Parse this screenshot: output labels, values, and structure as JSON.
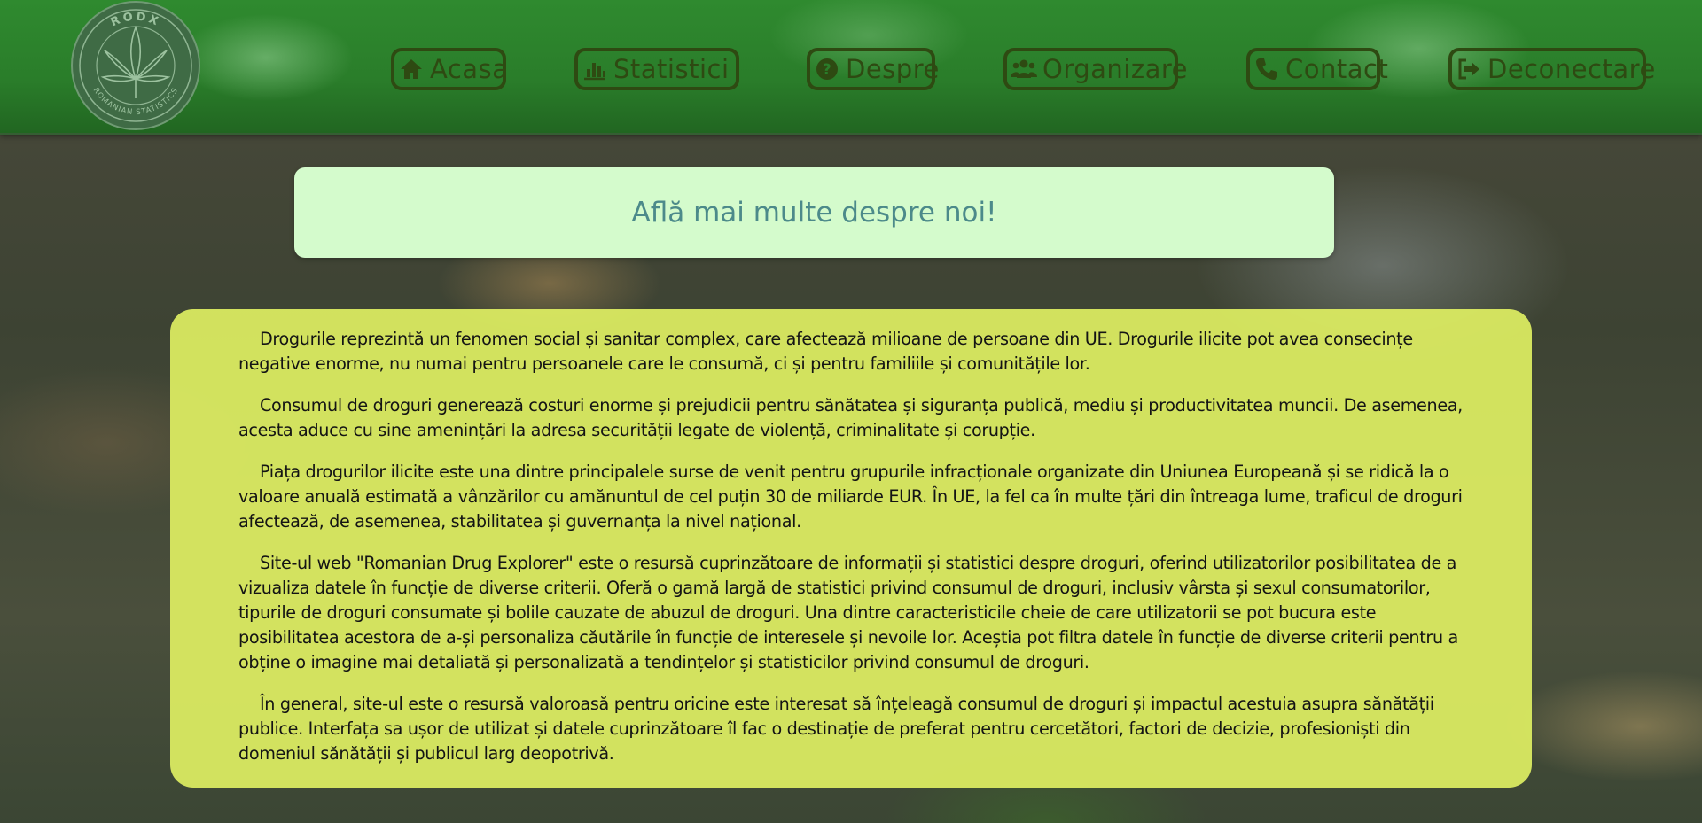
{
  "nav": {
    "logo_text_top": "RODX",
    "logo_text_bottom": "ROMANIAN STATISTICS",
    "items": [
      {
        "label": "Acasa",
        "icon": "home-icon"
      },
      {
        "label": "Statistici",
        "icon": "bar-chart-icon"
      },
      {
        "label": "Despre",
        "icon": "question-circle-icon"
      },
      {
        "label": "Organizare",
        "icon": "users-icon"
      },
      {
        "label": "Contact",
        "icon": "phone-icon"
      },
      {
        "label": "Deconectare",
        "icon": "sign-out-icon"
      }
    ]
  },
  "title": "Află mai multe despre noi!",
  "paragraphs": [
    "Drogurile reprezintă un fenomen social și sanitar complex, care afectează milioane de persoane din UE. Drogurile ilicite pot avea consecințe negative enorme, nu numai pentru persoanele care le consumă, ci și pentru familiile și comunitățile lor.",
    "Consumul de droguri generează costuri enorme și prejudicii pentru sănătatea și siguranța publică, mediu și productivitatea muncii. De asemenea, acesta aduce cu sine amenințări la adresa securității legate de violență, criminalitate și corupție.",
    "Piața drogurilor ilicite este una dintre principalele surse de venit pentru grupurile infracționale organizate din Uniunea Europeană și se ridică la o valoare anuală estimată a vânzărilor cu amănuntul de cel puțin 30 de miliarde EUR. În UE, la fel ca în multe țări din întreaga lume, traficul de droguri afectează, de asemenea, stabilitatea și guvernanța la nivel național.",
    "Site-ul web \"Romanian Drug Explorer\" este o resursă cuprinzătoare de informații și statistici despre droguri, oferind utilizatorilor posibilitatea de a vizualiza datele în funcție de diverse criterii. Oferă o gamă largă de statistici privind consumul de droguri, inclusiv vârsta și sexul consumatorilor, tipurile de droguri consumate și bolile cauzate de abuzul de droguri. Una dintre caracteristicile cheie de care utilizatorii se pot bucura este posibilitatea acestora de a-și personaliza căutările în funcție de interesele și nevoile lor. Aceștia pot filtra datele în funcție de diverse criterii pentru a obține o imagine mai detaliată și personalizată a tendințelor și statisticilor privind consumul de droguri.",
    "În general, site-ul este o resursă valoroasă pentru oricine este interesat să înțeleagă consumul de droguri și impactul acestuia asupra sănătății publice. Interfața sa ușor de utilizat și datele cuprinzătoare îl fac o destinație de preferat pentru cercetători, factori de decizie, profesioniști din domeniul sănătății și publicul larg deopotrivă."
  ],
  "colors": {
    "nav_green": "#2a7d2a",
    "nav_button": "#2e4a12",
    "title_bg": "#d4fbcc",
    "title_text": "#4c8a8a",
    "content_bg": "#deee62"
  }
}
